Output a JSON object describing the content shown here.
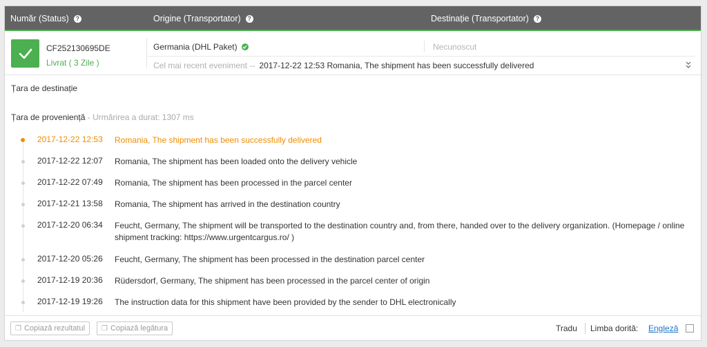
{
  "header": {
    "col_number": "Număr (Status)",
    "col_origin": "Origine (Transportator)",
    "col_destination": "Destinație (Transportator)"
  },
  "shipment": {
    "tracking_number": "CF252130695DE",
    "status": "Livrat ( 3 Zile )",
    "origin": "Germania (DHL Paket)",
    "destination": "Necunoscut",
    "latest_label": "Cel mai recent eveniment --",
    "latest_value": "2017-12-22 12:53 Romania, The shipment has been successfully delivered"
  },
  "details": {
    "destination_country_label": "Țara de destinație",
    "origin_country_label": "Țara de proveniență",
    "tracking_time": "- Urmărirea a durat: 1307 ms"
  },
  "events": [
    {
      "date": "2017-12-22 12:53",
      "desc": "Romania, The shipment has been successfully delivered"
    },
    {
      "date": "2017-12-22 12:07",
      "desc": "Romania, The shipment has been loaded onto the delivery vehicle"
    },
    {
      "date": "2017-12-22 07:49",
      "desc": "Romania, The shipment has been processed in the parcel center"
    },
    {
      "date": "2017-12-21 13:58",
      "desc": "Romania, The shipment has arrived in the destination country"
    },
    {
      "date": "2017-12-20 06:34",
      "desc": "Feucht, Germany, The shipment will be transported to the destination country and, from there, handed over to the delivery organization. (Homepage / online shipment tracking: https://www.urgentcargus.ro/ )"
    },
    {
      "date": "2017-12-20 05:26",
      "desc": "Feucht, Germany, The shipment has been processed in the destination parcel center"
    },
    {
      "date": "2017-12-19 20:36",
      "desc": "Rüdersdorf, Germany, The shipment has been processed in the parcel center of origin"
    },
    {
      "date": "2017-12-19 19:26",
      "desc": "The instruction data for this shipment have been provided by the sender to DHL electronically"
    }
  ],
  "footer": {
    "copy_result": "Copiază rezultatul",
    "copy_link": "Copiază legătura",
    "translate": "Tradu",
    "language_label": "Limba dorită:",
    "language_value": "Engleză"
  },
  "colors": {
    "header_bg": "#636363",
    "success": "#4caf50",
    "highlight": "#f08c00",
    "link": "#1a73c9"
  }
}
